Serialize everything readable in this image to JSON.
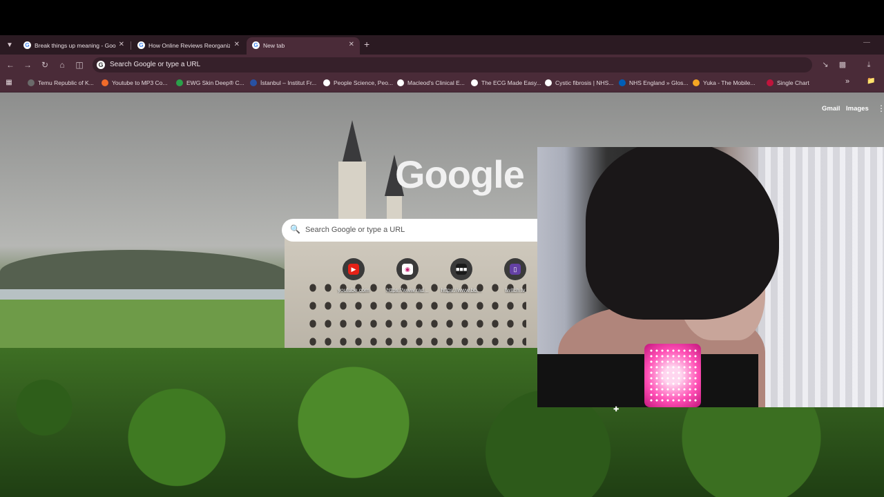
{
  "tabs": [
    {
      "title": "Break things up meaning - Goo",
      "active": false
    },
    {
      "title": "How Online Reviews Reorganiz",
      "active": false
    },
    {
      "title": "New tab",
      "active": true
    }
  ],
  "omnibox": {
    "placeholder": "Search Google or type a URL"
  },
  "bookmarks": [
    {
      "label": "Temu Republic of K...",
      "color": "#6a6a6a"
    },
    {
      "label": "Youtube to MP3 Co...",
      "color": "#f06b2a"
    },
    {
      "label": "EWG Skin Deep® C...",
      "color": "#2aa04a"
    },
    {
      "label": "İstanbul – Institut Fr...",
      "color": "#2851a3"
    },
    {
      "label": "People Science, Peo...",
      "color": "#ffffff"
    },
    {
      "label": "Macleod's Clinical E...",
      "color": "#ffffff"
    },
    {
      "label": "The ECG Made Easy...",
      "color": "#ffffff"
    },
    {
      "label": "Cystic fibrosis | NHS...",
      "color": "#ffffff"
    },
    {
      "label": "NHS England » Glos...",
      "color": "#005eb8"
    },
    {
      "label": "Yuka - The Mobile...",
      "color": "#f5a623"
    },
    {
      "label": "Single Chart",
      "color": "#c0143c"
    }
  ],
  "ntp": {
    "gmail": "Gmail",
    "images": "Images",
    "logo": "Google",
    "search_placeholder": "Search Google or type a URL",
    "shortcuts": [
      {
        "label": "youtube.com",
        "icon": "youtube-icon",
        "color": "#e62117"
      },
      {
        "label": "https://www.rad...",
        "icon": "radio-icon",
        "color": "#ffffff"
      },
      {
        "label": "https://www.bb...",
        "icon": "bbc-icon",
        "color": "#1a1a1a"
      },
      {
        "label": "twitch.tv",
        "icon": "twitch-icon",
        "color": "#6441a5"
      }
    ]
  },
  "colors": {
    "frame": "#2b1a22",
    "toolbar": "#4a2b38",
    "accent": "#4285f4"
  }
}
